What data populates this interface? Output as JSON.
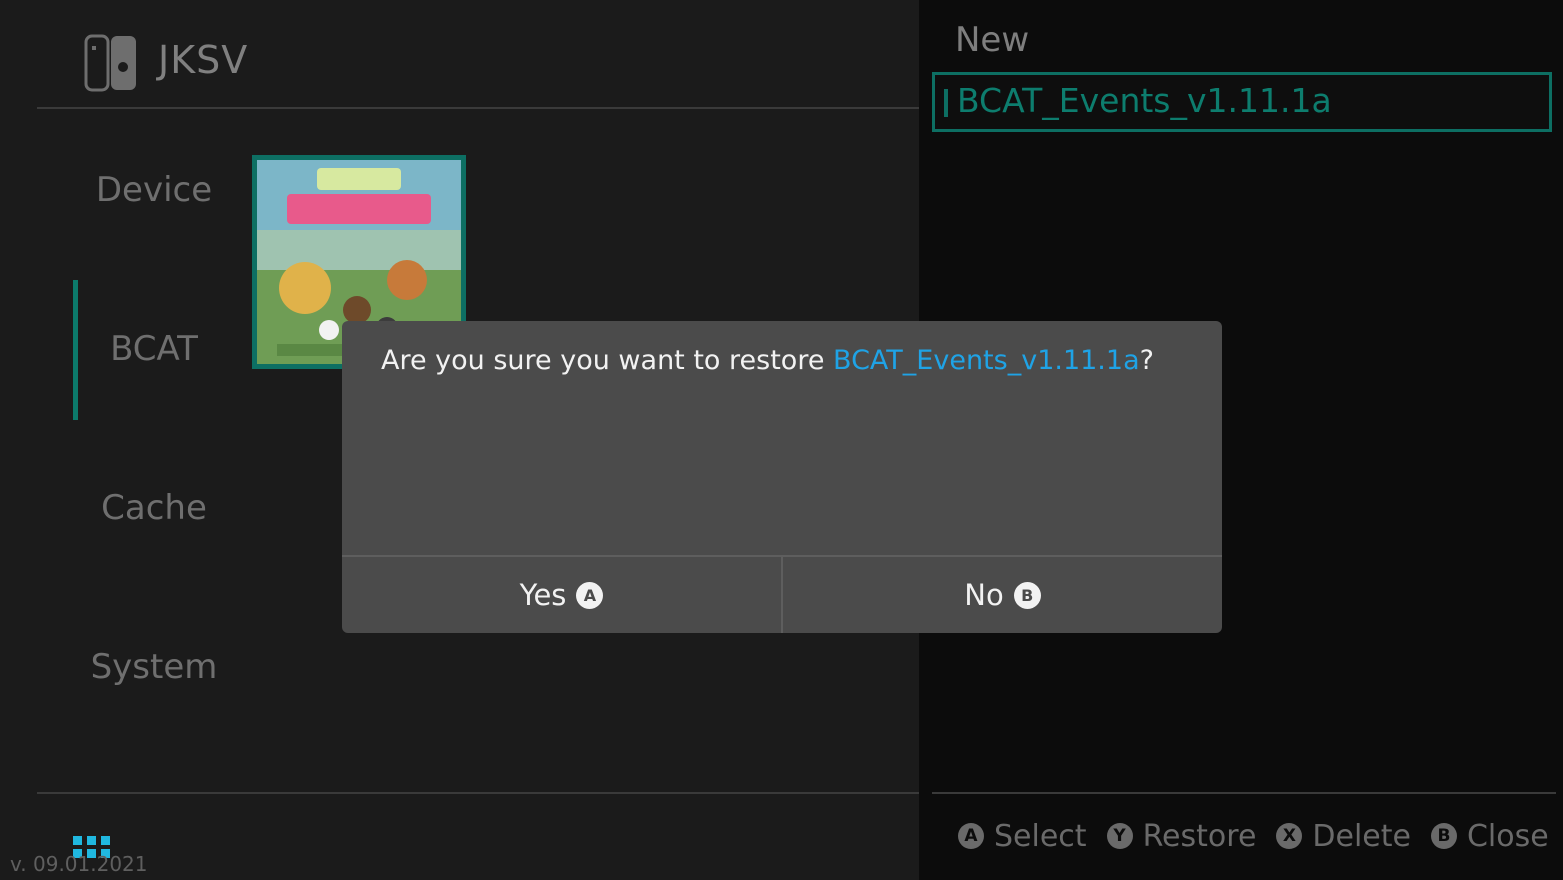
{
  "app": {
    "title": "JKSV",
    "version": "v. 09.01.2021"
  },
  "sidebar": {
    "items": [
      {
        "label": "Device"
      },
      {
        "label": "BCAT"
      },
      {
        "label": "Cache"
      },
      {
        "label": "System"
      }
    ],
    "active_index": 1
  },
  "game_thumbnail": {
    "icon": "animal-crossing-cover-art"
  },
  "file_list": {
    "header": "New",
    "items": [
      {
        "label": "BCAT_Events_v1.11.1a"
      }
    ],
    "selected_index": 0
  },
  "controls": [
    {
      "button": "A",
      "label": "Select"
    },
    {
      "button": "Y",
      "label": "Restore"
    },
    {
      "button": "X",
      "label": "Delete"
    },
    {
      "button": "B",
      "label": "Close"
    }
  ],
  "dialog": {
    "message_prefix": "Are you sure you want to restore ",
    "message_highlight": "BCAT_Events_v1.11.1a",
    "message_suffix": "?",
    "yes_label": "Yes",
    "yes_button": "A",
    "no_label": "No",
    "no_button": "B"
  },
  "colors": {
    "accent": "#0d6f63",
    "highlight": "#1fa3e6",
    "dialog_bg": "#4b4b4b"
  }
}
